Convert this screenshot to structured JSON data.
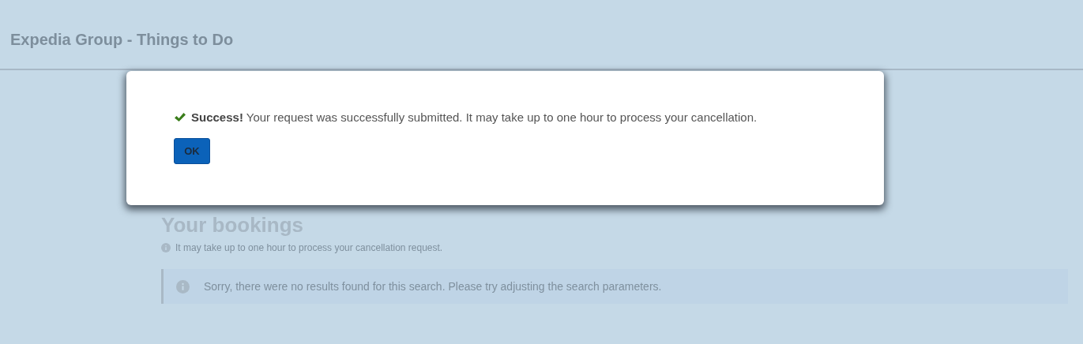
{
  "header": {
    "title": "Expedia Group - Things to Do"
  },
  "dialog": {
    "kind": "success",
    "message": "**Success!** Your request was successfully submitted. It may take up to one hour to process your cancellation.",
    "button": "OK"
  },
  "bookings": {
    "heading": "Your bookings",
    "note": "It may take up to one hour to process your cancellation request.",
    "alert": "Sorry, there were no results found for this search. Please try adjusting the search parameters."
  }
}
